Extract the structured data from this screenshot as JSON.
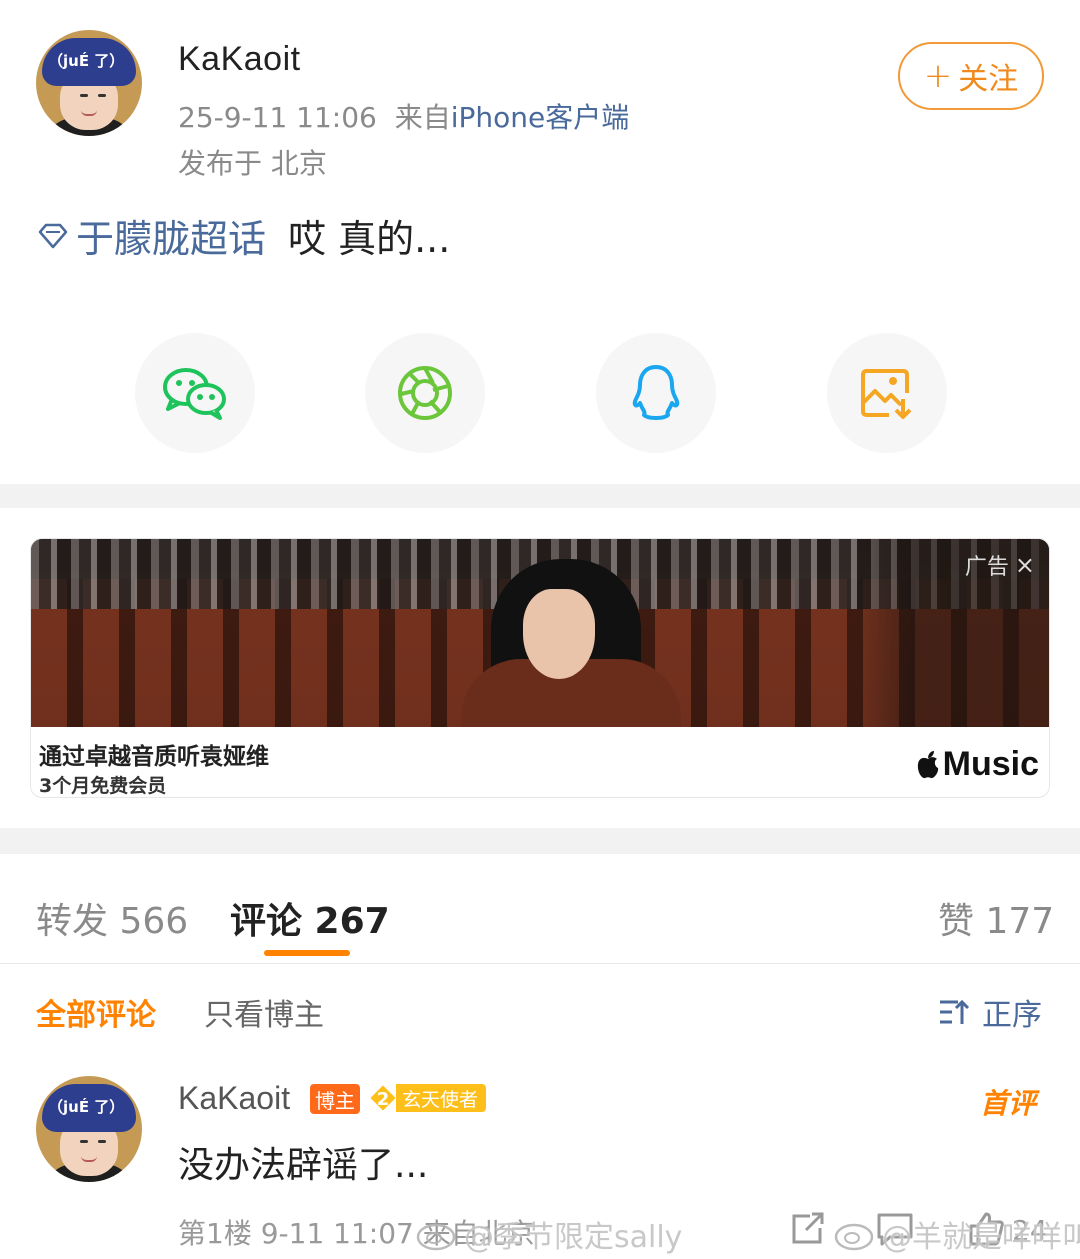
{
  "post": {
    "author": "KaKaoit",
    "time": "25-9-11 11:06",
    "from_prefix": "来自",
    "source": "iPhone客户端",
    "location": "发布于 北京",
    "follow_label": "关注",
    "follow_plus": "+",
    "topic": "于朦胧超话",
    "text": "哎 真的...",
    "avatar_cap_text": "（juÉ 了）"
  },
  "share": {
    "items": [
      {
        "name": "wechat",
        "icon": "wechat-icon",
        "color": "#1fc35b"
      },
      {
        "name": "moments",
        "icon": "moments-icon",
        "color": "#6cc63b"
      },
      {
        "name": "qq",
        "icon": "qq-icon",
        "color": "#1aa7f0"
      },
      {
        "name": "save-image",
        "icon": "save-image-icon",
        "color": "#f5a623"
      }
    ]
  },
  "ad": {
    "label": "广告",
    "close": "×",
    "title": "通过卓越音质听袁娅维",
    "subtitle": "3个月免费会员",
    "brand": "Music"
  },
  "tabs": {
    "repost": "转发 566",
    "comments": "评论 267",
    "likes": "赞 177"
  },
  "filters": {
    "all": "全部评论",
    "author_only": "只看博主",
    "sort": "正序"
  },
  "comment": {
    "author": "KaKaoit",
    "badge_blogger": "博主",
    "fan_level": "2",
    "badge_fan": "玄天使者",
    "first_tag": "首评",
    "text": "没办法辟谣了...",
    "meta": "第1楼 9-11 11:07 来自北京",
    "likes": "24"
  },
  "watermarks": {
    "left": "@季节限定sally",
    "right": "@羊就是咩咩叫"
  },
  "colors": {
    "accent": "#ff8200",
    "link": "#4a6a9b",
    "separator": "#f2f2f2"
  }
}
